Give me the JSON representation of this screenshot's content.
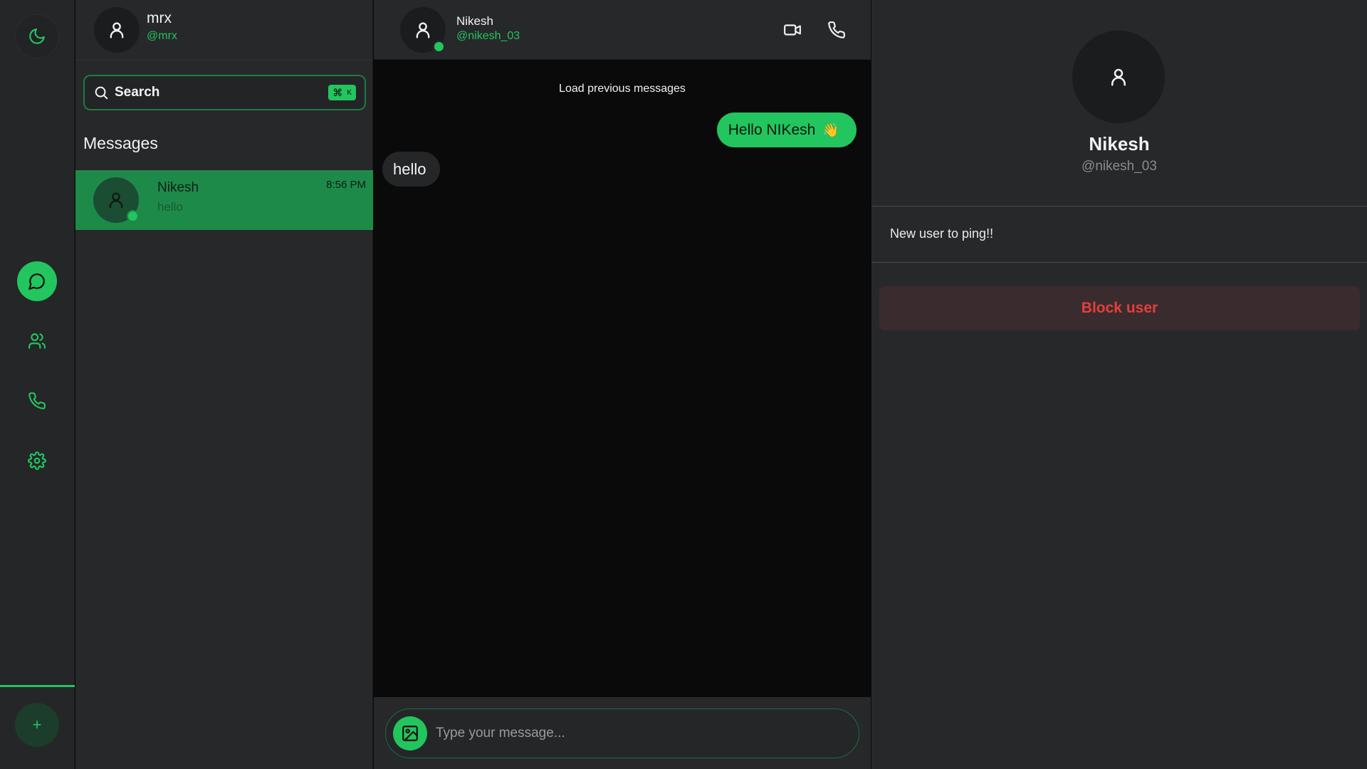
{
  "rail": {
    "icons": {
      "theme": "moon-icon",
      "chats": "chat-bubble-icon",
      "friends": "users-icon",
      "calls": "phone-icon",
      "settings": "gear-icon",
      "add": "plus-icon"
    },
    "add_label": "+"
  },
  "me": {
    "name": "mrx",
    "handle": "@mrx"
  },
  "search": {
    "label": "Search",
    "shortcut_symbol": "⌘",
    "shortcut_key": "K"
  },
  "messages": {
    "title": "Messages",
    "conversations": [
      {
        "name": "Nikesh",
        "last_message": "hello",
        "time": "8:56 PM",
        "online": true,
        "selected": true
      }
    ]
  },
  "chat": {
    "peer_name": "Nikesh",
    "peer_handle": "@nikesh_03",
    "load_previous": "Load previous messages",
    "messages": [
      {
        "direction": "out",
        "text": "Hello NIKesh",
        "emoji": "👋"
      },
      {
        "direction": "in",
        "text": "hello"
      }
    ],
    "composer_placeholder": "Type your message..."
  },
  "profile": {
    "name": "Nikesh",
    "handle": "@nikesh_03",
    "bio": "New user to ping!!",
    "block_label": "Block user"
  },
  "colors": {
    "accent": "#22c55e",
    "selected_row": "#1e8a4a",
    "panel": "#27282a",
    "chat_bg": "#0a0a0a",
    "danger": "#e53e3e"
  }
}
